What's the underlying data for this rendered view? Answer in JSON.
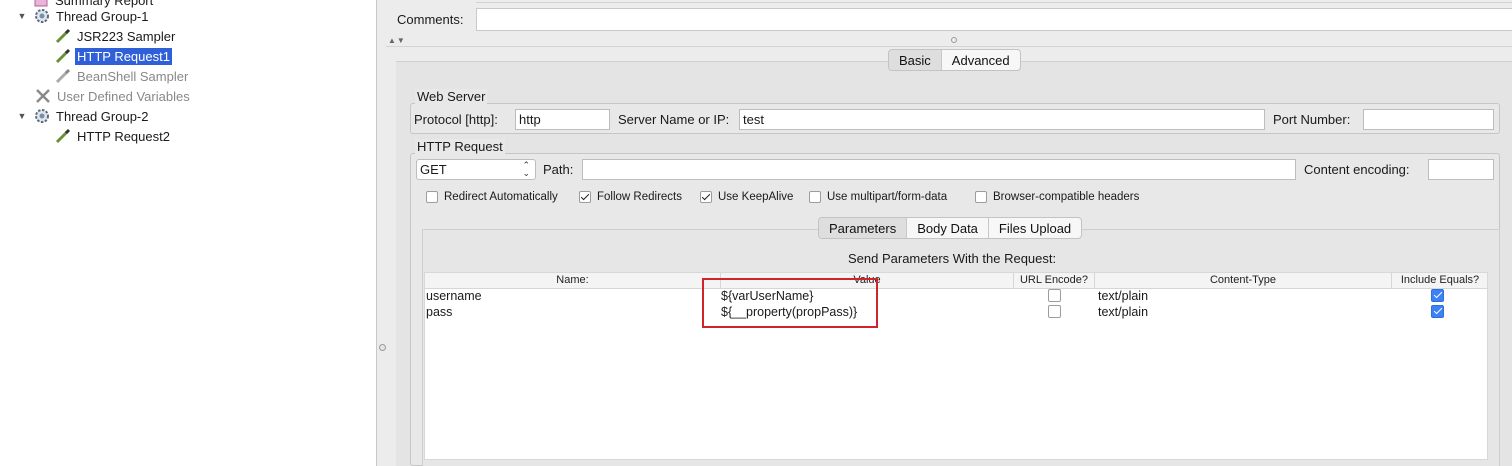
{
  "tree": {
    "items": [
      {
        "label": "Summary Report",
        "state": "normal"
      },
      {
        "label": "Thread Group-1",
        "state": "normal"
      },
      {
        "label": "JSR223 Sampler",
        "state": "normal"
      },
      {
        "label": "HTTP Request1",
        "state": "selected"
      },
      {
        "label": "BeanShell Sampler",
        "state": "disabled"
      },
      {
        "label": "User Defined Variables",
        "state": "disabled"
      },
      {
        "label": "Thread Group-2",
        "state": "normal"
      },
      {
        "label": "HTTP Request2",
        "state": "normal"
      }
    ]
  },
  "comments": {
    "label": "Comments:",
    "value": ""
  },
  "main_tabs": [
    "Basic",
    "Advanced"
  ],
  "web_server": {
    "title": "Web Server",
    "protocol_label": "Protocol [http]:",
    "protocol_value": "http",
    "server_label": "Server Name or IP:",
    "server_value": "test",
    "port_label": "Port Number:",
    "port_value": ""
  },
  "http_request": {
    "title": "HTTP Request",
    "method": "GET",
    "path_label": "Path:",
    "path_value": "",
    "encoding_label": "Content encoding:",
    "encoding_value": "",
    "options": [
      {
        "label": "Redirect Automatically",
        "checked": false
      },
      {
        "label": "Follow Redirects",
        "checked": true
      },
      {
        "label": "Use KeepAlive",
        "checked": true
      },
      {
        "label": "Use multipart/form-data",
        "checked": false
      },
      {
        "label": "Browser-compatible headers",
        "checked": false
      }
    ]
  },
  "sub_tabs": [
    "Parameters",
    "Body Data",
    "Files Upload"
  ],
  "params": {
    "title": "Send Parameters With the Request:",
    "columns": [
      "Name:",
      "Value",
      "URL Encode?",
      "Content-Type",
      "Include Equals?"
    ],
    "rows": [
      {
        "name": "username",
        "value": "${varUserName}",
        "url_encode": false,
        "content_type": "text/plain",
        "include_equals": true
      },
      {
        "name": "pass",
        "value": "${__property(propPass)}",
        "url_encode": false,
        "content_type": "text/plain",
        "include_equals": true
      }
    ]
  },
  "colors": {
    "selection": "#2f60d8",
    "highlight": "#d0242b",
    "checkbox_checked": "#3b82f6"
  }
}
